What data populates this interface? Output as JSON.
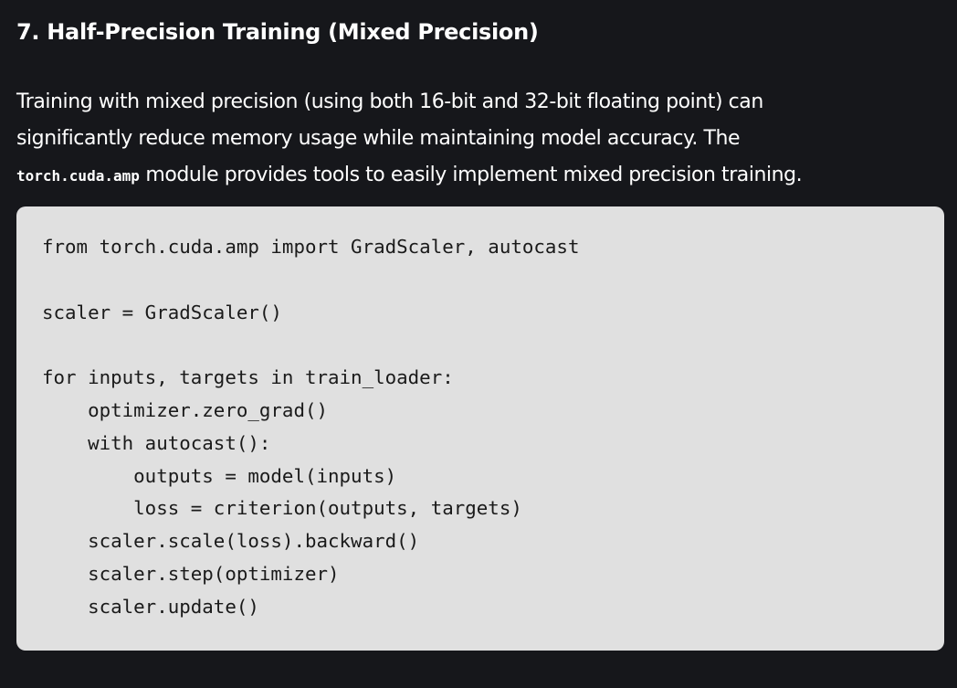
{
  "section": {
    "heading": "7. Half-Precision Training (Mixed Precision)",
    "paragraph": {
      "line1": "Training with mixed precision (using both 16-bit and 32-bit floating point) can",
      "line2": "significantly reduce memory usage while maintaining model accuracy. The",
      "inline_code": "torch.cuda.amp",
      "line3_rest": " module provides tools to easily implement mixed precision training."
    },
    "code_block": {
      "lines": [
        "from torch.cuda.amp import GradScaler, autocast",
        "",
        "scaler = GradScaler()",
        "",
        "for inputs, targets in train_loader:",
        "    optimizer.zero_grad()",
        "    with autocast():",
        "        outputs = model(inputs)",
        "        loss = criterion(outputs, targets)",
        "    scaler.scale(loss).backward()",
        "    scaler.step(optimizer)",
        "    scaler.update()"
      ]
    }
  },
  "colors": {
    "page_background": "#16171b",
    "text": "#ffffff",
    "code_background": "#e0e0e0",
    "code_text": "#1a1a1a"
  }
}
